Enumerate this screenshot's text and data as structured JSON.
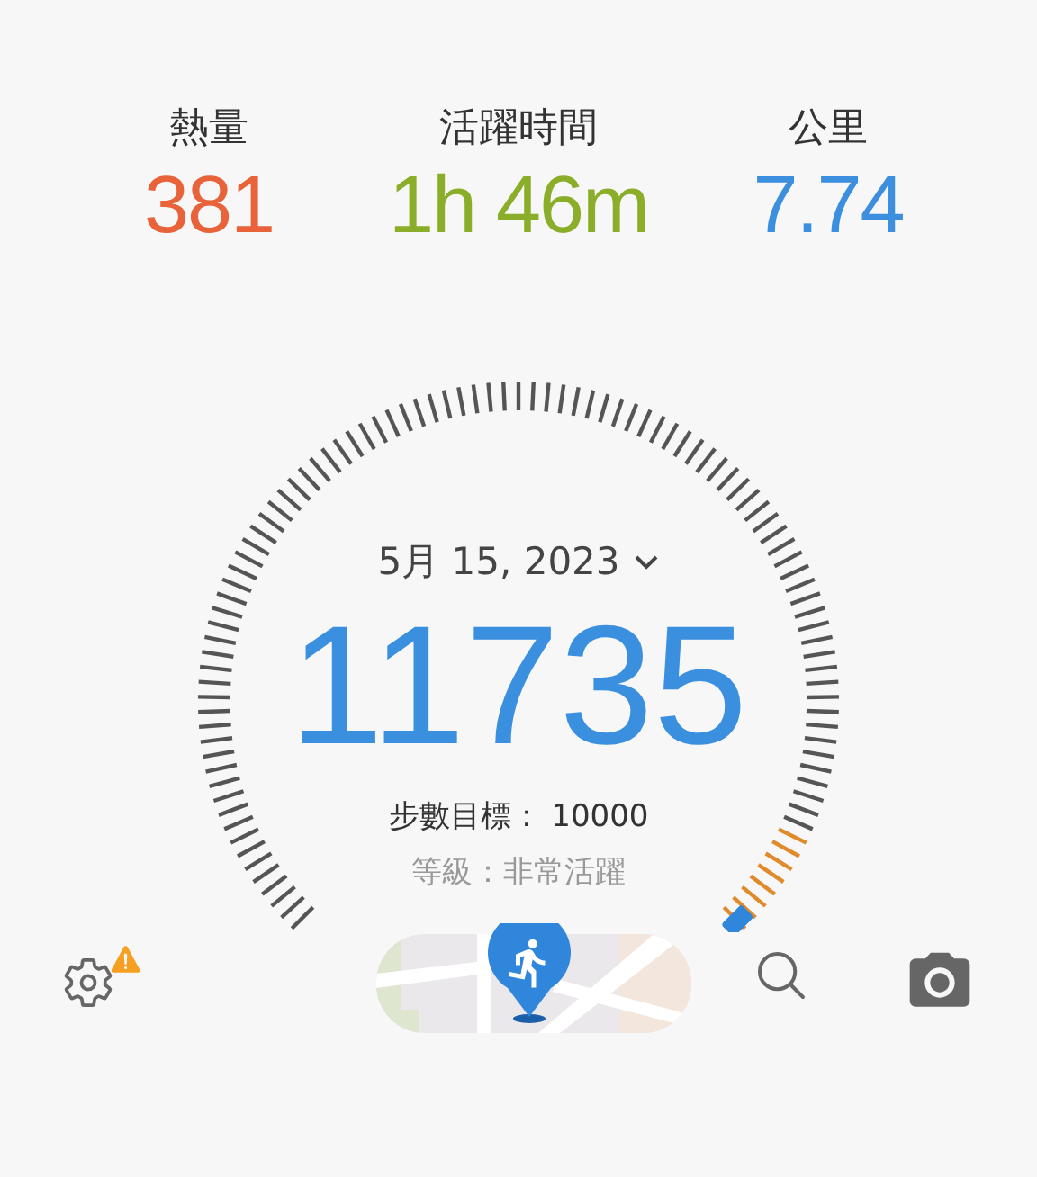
{
  "stats": [
    {
      "label": "熱量",
      "value": "381",
      "color": "#e8633a"
    },
    {
      "label": "活躍時間",
      "value": "1h 46m",
      "color": "#8aae2a"
    },
    {
      "label": "公里",
      "value": "7.74",
      "color": "#3b8fde"
    }
  ],
  "gauge": {
    "date": "5月 15, 2023",
    "steps": "11735",
    "goal": "步數目標： 10000",
    "grade": "等級：非常活躍"
  },
  "toolbar": {
    "settings_warning": true
  }
}
